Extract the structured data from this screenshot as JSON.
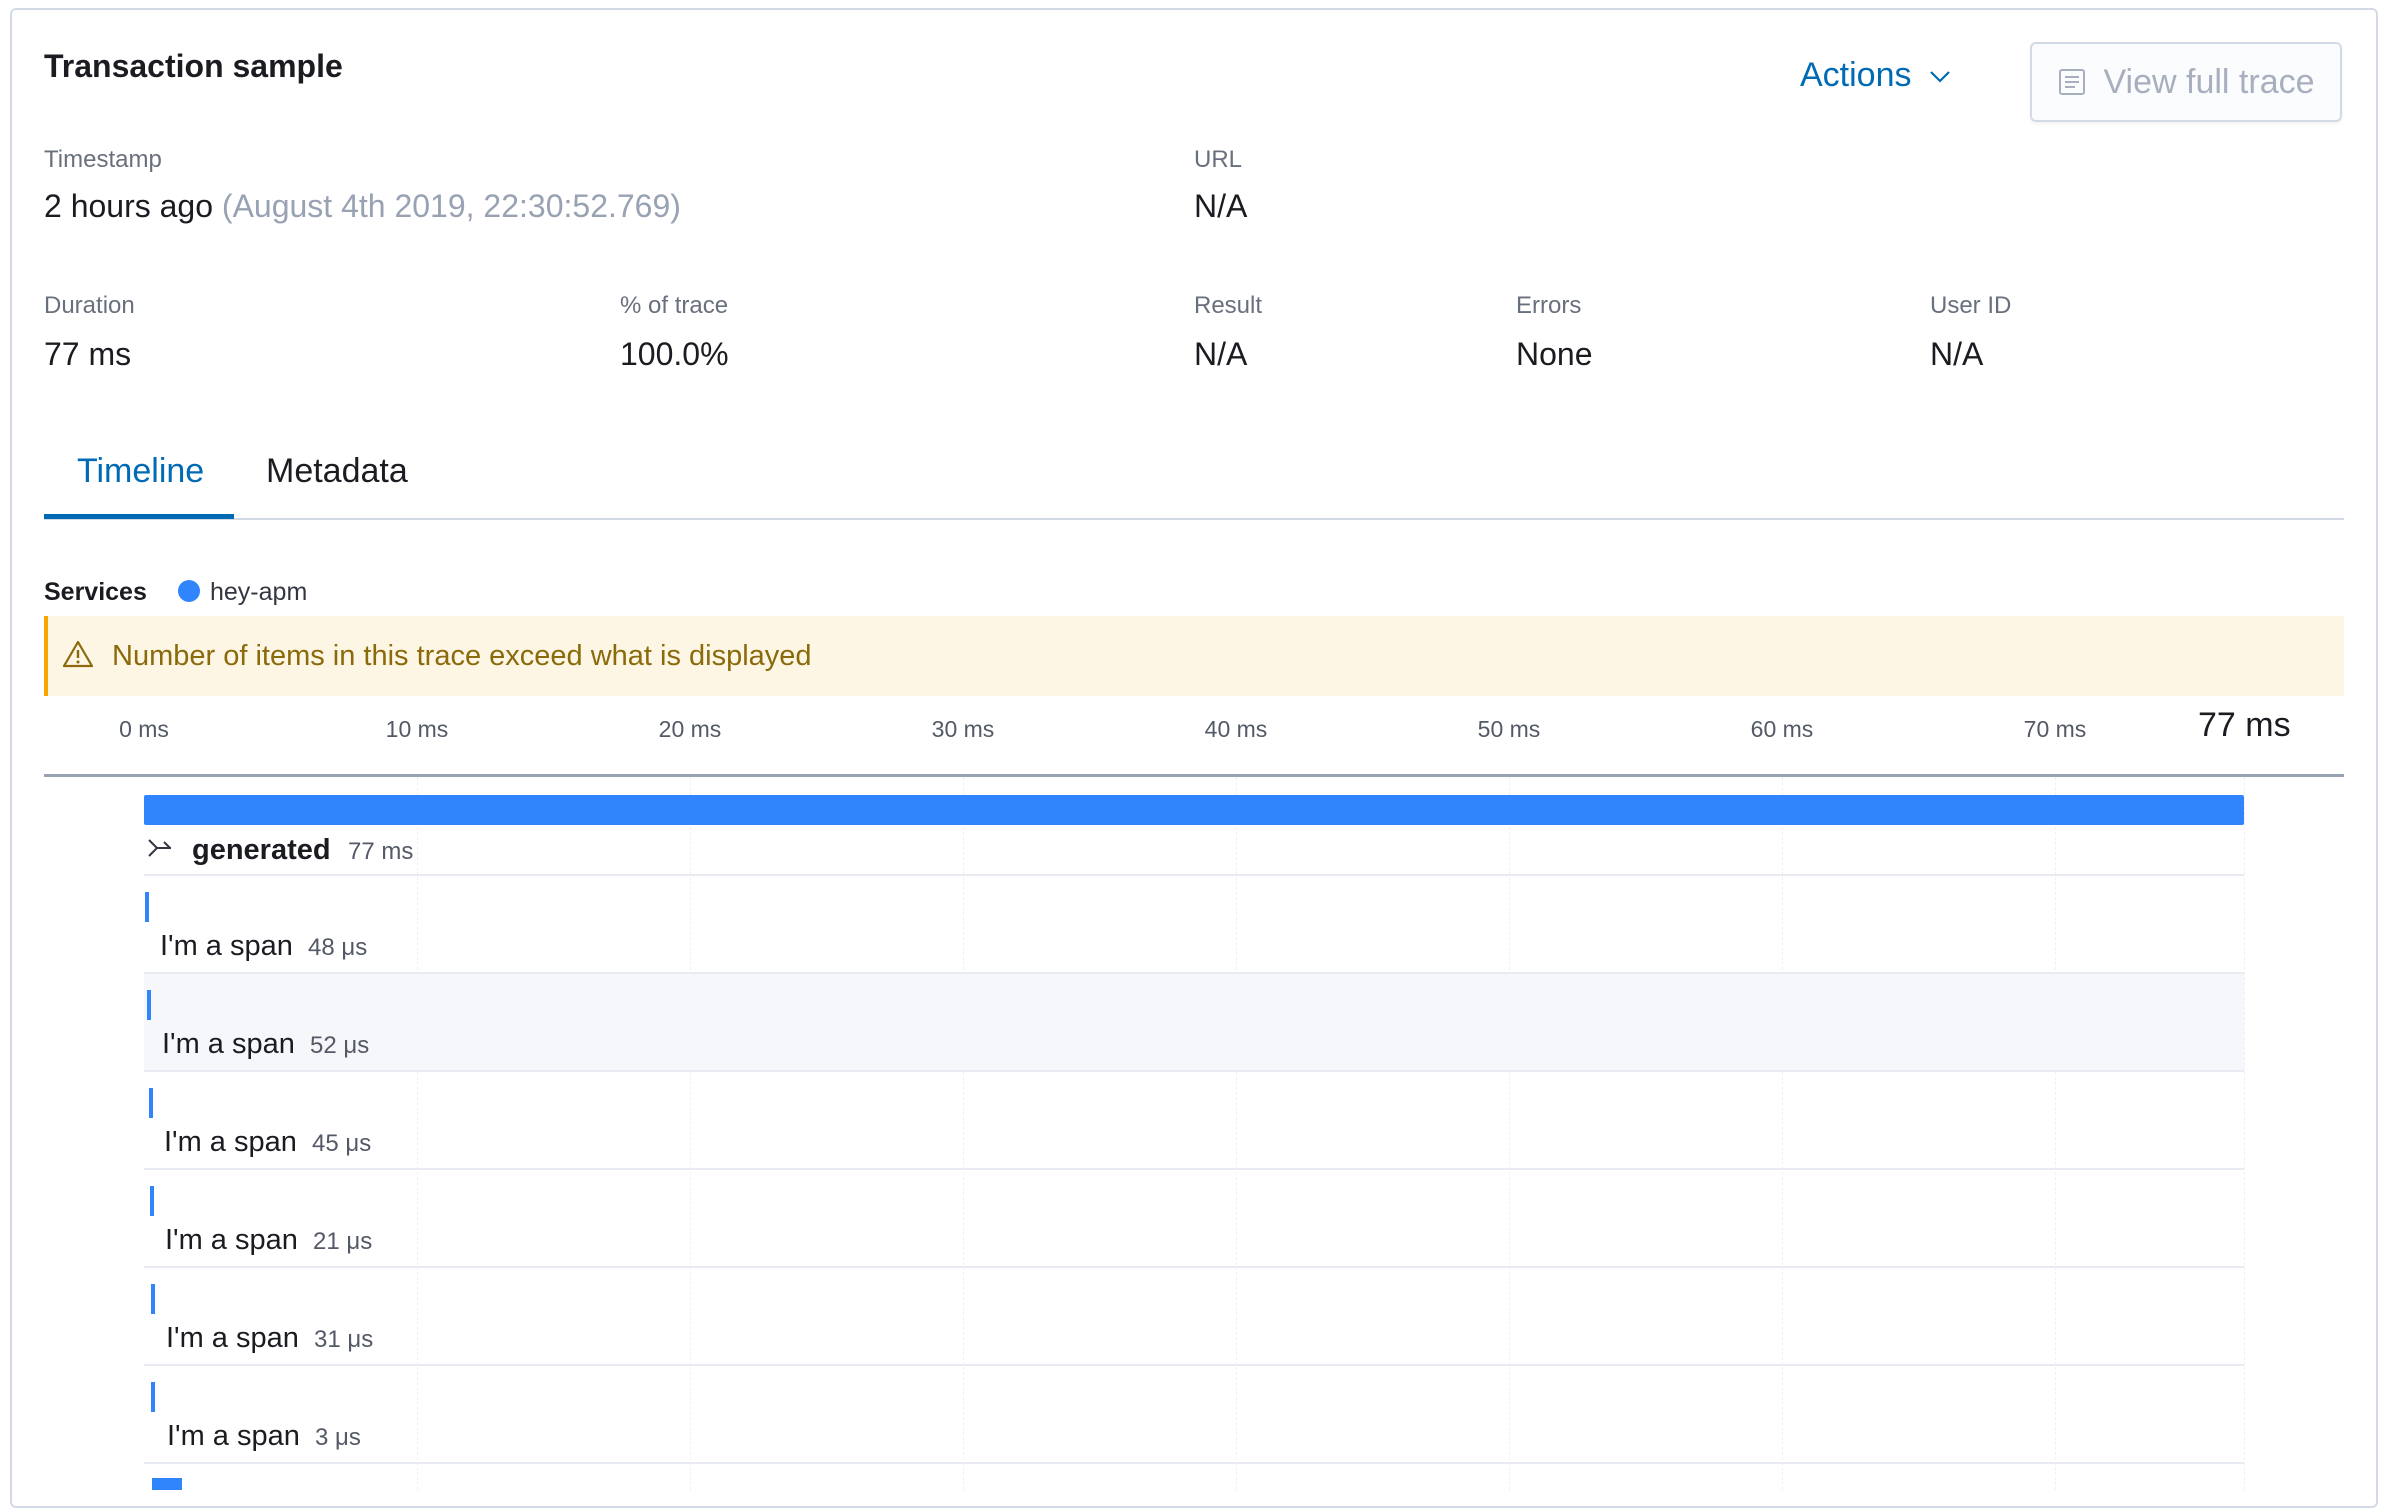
{
  "header": {
    "title": "Transaction sample",
    "actions_label": "Actions",
    "view_full_trace_label": "View full trace"
  },
  "summary": {
    "timestamp": {
      "label": "Timestamp",
      "relative": "2 hours ago",
      "absolute": "(August 4th 2019, 22:30:52.769)"
    },
    "url": {
      "label": "URL",
      "value": "N/A"
    },
    "duration": {
      "label": "Duration",
      "value": "77 ms"
    },
    "pct_of_trace": {
      "label": "% of trace",
      "value": "100.0%"
    },
    "result": {
      "label": "Result",
      "value": "N/A"
    },
    "errors": {
      "label": "Errors",
      "value": "None"
    },
    "user_id": {
      "label": "User ID",
      "value": "N/A"
    }
  },
  "tabs": [
    {
      "label": "Timeline",
      "active": true
    },
    {
      "label": "Metadata",
      "active": false
    }
  ],
  "services": {
    "label": "Services",
    "items": [
      {
        "name": "hey-apm",
        "color": "#3185fc"
      }
    ]
  },
  "callout": {
    "text": "Number of items in this trace exceed what is displayed",
    "icon": "warning-icon"
  },
  "timeline": {
    "ticks": [
      "0 ms",
      "10 ms",
      "20 ms",
      "30 ms",
      "40 ms",
      "50 ms",
      "60 ms",
      "70 ms"
    ],
    "end_label": "77 ms",
    "transaction": {
      "name": "generated",
      "duration": "77 ms",
      "icon": "merge-icon"
    },
    "spans": [
      {
        "name": "I'm a span",
        "duration": "48 μs"
      },
      {
        "name": "I'm a span",
        "duration": "52 μs"
      },
      {
        "name": "I'm a span",
        "duration": "45 μs"
      },
      {
        "name": "I'm a span",
        "duration": "21 μs"
      },
      {
        "name": "I'm a span",
        "duration": "31 μs"
      },
      {
        "name": "I'm a span",
        "duration": "3 μs"
      }
    ]
  },
  "colors": {
    "accent": "#006bb4",
    "service": "#3185fc",
    "warning_bg": "#fef6e5",
    "warning_text": "#8a6a0a"
  }
}
